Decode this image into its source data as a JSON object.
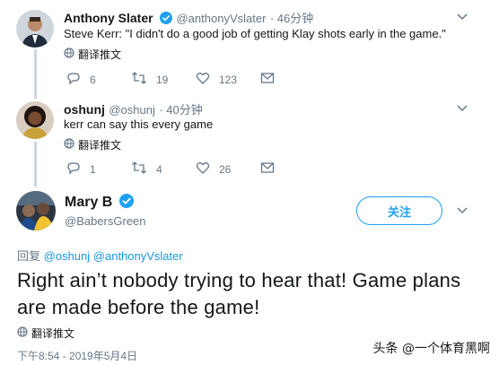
{
  "tweets": [
    {
      "name": "Anthony Slater",
      "handle": "@anthonyVslater",
      "time": "· 46分钟",
      "text": "Steve Kerr: \"I didn't do a good job of getting Klay shots early in the game.\"",
      "translate_label": "翻译推文",
      "replies": "6",
      "retweets": "19",
      "likes": "123",
      "verified": true
    },
    {
      "name": "oshunj",
      "handle": "@oshunj",
      "time": "· 40分钟",
      "text": "kerr can say this every game",
      "translate_label": "翻译推文",
      "replies": "1",
      "retweets": "4",
      "likes": "26",
      "verified": false
    }
  ],
  "main_tweet": {
    "name": "Mary B",
    "handle": "@BabersGreen",
    "follow_label": "关注",
    "reply_prefix": "回复",
    "reply_mention_1": "@oshunj",
    "reply_mention_2": "@anthonyVslater",
    "text": "Right ain’t nobody trying to hear  that! Game plans are made before the game!",
    "translate_label": "翻译推文",
    "timestamp": "下午8:54 - 2019年5月4日"
  },
  "watermark": "头条 @一个体育黑啊",
  "colors": {
    "accent": "#1da1f2",
    "muted": "#657786",
    "line": "#ccd6dd"
  }
}
